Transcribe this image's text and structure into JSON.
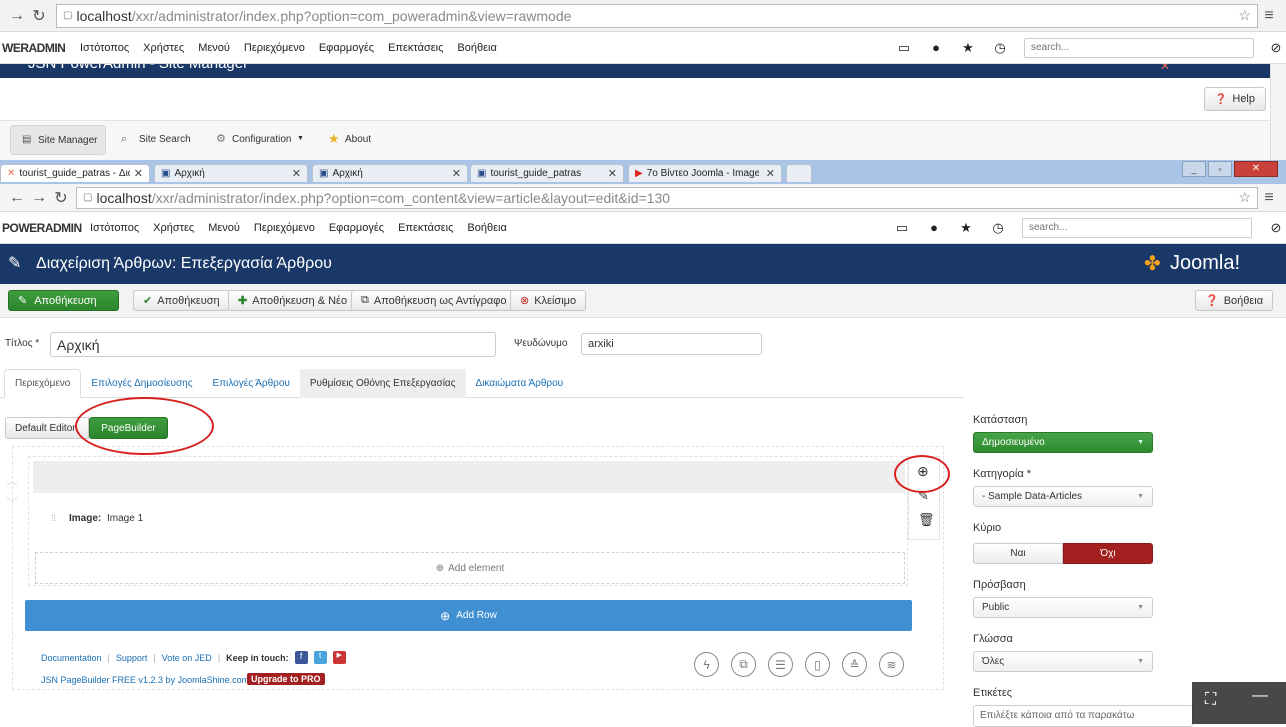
{
  "browser1": {
    "url_host": "localhost",
    "url_path": "/xxr/administrator/index.php?option=com_poweradmin&view=rawmode"
  },
  "menu1": {
    "brand": "WERADMIN",
    "items": [
      "Ιστότοπος",
      "Χρήστες",
      "Μενού",
      "Περιεχόμενο",
      "Εφαρμογές",
      "Επεκτάσεις",
      "Βοήθεια"
    ],
    "search_placeholder": "search..."
  },
  "bg_title": {
    "text": "JSN PowerAdmin - Site Manager"
  },
  "help_button": {
    "label": "Help"
  },
  "subnav": {
    "items": [
      "Site Manager",
      "Site Search",
      "Configuration",
      "About"
    ]
  },
  "tabs": [
    {
      "label": "tourist_guide_patras - Διαχείριση"
    },
    {
      "label": "Αρχική"
    },
    {
      "label": "Αρχική"
    },
    {
      "label": "tourist_guide_patras"
    },
    {
      "label": "7ο Βίντεο Joomla - Image"
    }
  ],
  "browser2": {
    "url_host": "localhost",
    "url_path": "/xxr/administrator/index.php?option=com_content&view=article&layout=edit&id=130"
  },
  "menu2": {
    "brand": "POWERADMIN",
    "items": [
      "Ιστότοπος",
      "Χρήστες",
      "Μενού",
      "Περιεχόμενο",
      "Εφαρμογές",
      "Επεκτάσεις",
      "Βοήθεια"
    ],
    "search_placeholder": "search..."
  },
  "header": {
    "title": "Διαχείριση Άρθρων: Επεξεργασία Άρθρου",
    "logo_text": "Joomla!"
  },
  "toolbar": {
    "save": "Αποθήκευση",
    "save_close": "Αποθήκευση",
    "save_new": "Αποθήκευση & Νέο",
    "save_copy": "Αποθήκευση ως Αντίγραφο",
    "close": "Κλείσιμο",
    "help": "Βοήθεια"
  },
  "form": {
    "title_label": "Τίτλος *",
    "title_value": "Αρχική",
    "alias_label": "Ψευδώνυμο",
    "alias_value": "arxiki"
  },
  "content_tabs": [
    "Περιεχόμενο",
    "Επιλογές Δημοσίευσης",
    "Επιλογές Άρθρου",
    "Ρυθμίσεις Οθόνης Επεξεργασίας",
    "Δικαιώματα Άρθρου"
  ],
  "editor_toggle": {
    "default": "Default Editor",
    "pagebuilder": "PageBuilder"
  },
  "builder": {
    "element_label": "Image:",
    "element_value": "Image 1",
    "add_element": "Add element",
    "add_row": "Add Row"
  },
  "footer": {
    "links": [
      "Documentation",
      "Support",
      "Vote on JED"
    ],
    "keep_in_touch": "Keep in touch:",
    "version": "JSN PageBuilder FREE v1.2.3 by JoomlaShine.com",
    "upgrade": "Upgrade to PRO"
  },
  "sidebar": {
    "status_label": "Κατάσταση",
    "status_value": "Δημοσιευμένο",
    "category_label": "Κατηγορία *",
    "category_value": "- Sample Data-Articles",
    "featured_label": "Κύριο",
    "featured_yes": "Ναι",
    "featured_no": "Όχι",
    "access_label": "Πρόσβαση",
    "access_value": "Public",
    "language_label": "Γλώσσα",
    "language_value": "Όλες",
    "tags_label": "Ετικέτες",
    "tags_placeholder": "Επιλέξτε κάποια από τα παρακάτω"
  },
  "colors": {
    "joomla_blue": "#1a3867",
    "green": "#2f8a2f",
    "red": "#a32020",
    "annotation_red": "#d8201f",
    "add_row_blue": "#3f8fd2"
  }
}
